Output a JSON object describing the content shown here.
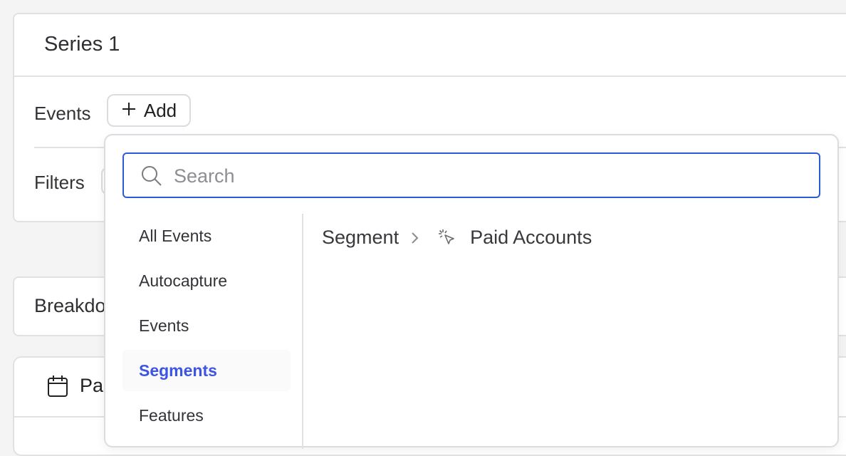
{
  "series": {
    "title": "Series 1"
  },
  "events_row": {
    "label": "Events",
    "add_label": "Add",
    "add_icon": "plus-icon"
  },
  "filters_row": {
    "label": "Filters"
  },
  "breakdown": {
    "label": "Breakdo"
  },
  "date_range": {
    "label": "Pa",
    "icon": "calendar-icon"
  },
  "dropdown": {
    "search": {
      "placeholder": "Search",
      "value": ""
    },
    "categories": [
      {
        "label": "All Events",
        "active": false
      },
      {
        "label": "Autocapture",
        "active": false
      },
      {
        "label": "Events",
        "active": false
      },
      {
        "label": "Segments",
        "active": true
      },
      {
        "label": "Features",
        "active": false
      }
    ],
    "breadcrumb": {
      "parent": "Segment",
      "item": "Paid Accounts",
      "item_icon": "pointer-click-icon"
    }
  },
  "colors": {
    "accent": "#3d55e0",
    "search_border": "#2d5bd8",
    "border": "#e1e1e4"
  }
}
